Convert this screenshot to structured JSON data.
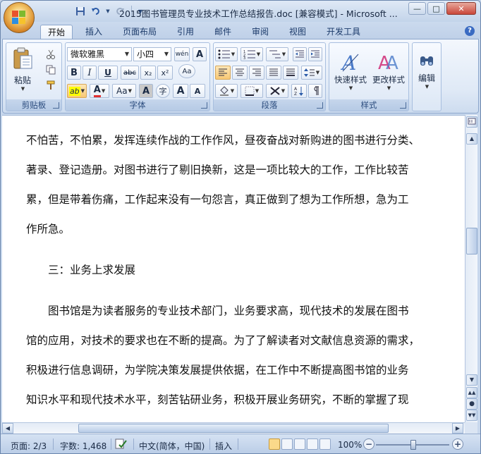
{
  "window": {
    "title": "2015图书管理员专业技术工作总结报告.doc [兼容模式] - Microsoft ...",
    "controls": {
      "minimize": "—",
      "maximize": "□",
      "close": "✕"
    }
  },
  "tabs": [
    "开始",
    "插入",
    "页面布局",
    "引用",
    "邮件",
    "审阅",
    "视图",
    "开发工具"
  ],
  "help": "?",
  "ribbon": {
    "clipboard": {
      "label": "剪贴板",
      "paste": "粘贴"
    },
    "font": {
      "label": "字体",
      "font_name": "微软雅黑",
      "font_size": "小四",
      "phonetic": "wén",
      "bold": "B",
      "italic": "I",
      "underline": "U",
      "strike": "abc",
      "subscript": "x₂",
      "superscript": "x²",
      "clear": "Aa",
      "highlight": "ab",
      "font_color": "A",
      "case": "Aa",
      "shading": "A",
      "enclose": "字",
      "grow": "A",
      "shrink": "A"
    },
    "paragraph": {
      "label": "段落"
    },
    "styles": {
      "label": "样式",
      "quick_styles": "快速样式",
      "change_styles": "更改样式"
    },
    "editing": {
      "label": "编辑"
    }
  },
  "document": {
    "lines": [
      "不怕苦，不怕累，发挥连续作战的工作作风，昼夜奋战对新购进的图书进行分类、",
      "著录、登记造册。对图书进行了剔旧换新，这是一项比较大的工作，工作比较苦",
      "累，但是带着伤痛，工作起来没有一句怨言，真正做到了想为工作所想，急为工",
      "作所急。",
      "",
      "　　三：业务上求发展",
      "",
      "　　图书馆是为读者服务的专业技术部门，业务要求高，现代技术的发展在图书",
      "馆的应用，对技术的要求也在不断的提高。为了了解读者对文献信息资源的需求，",
      "积极进行信息调研，为学院决策发展提供依据，在工作中不断提高图书馆的业务",
      "知识水平和现代技术水平，刻苦钻研业务，积极开展业务研究，不断的掌握了现"
    ]
  },
  "statusbar": {
    "page": "页面: 2/3",
    "words": "字数: 1,468",
    "language": "中文(简体，中国)",
    "mode": "插入",
    "zoom": "100%"
  },
  "colors": {
    "accent": "#2b579a",
    "highlight": "#ffff00",
    "font_color": "#e03030"
  }
}
